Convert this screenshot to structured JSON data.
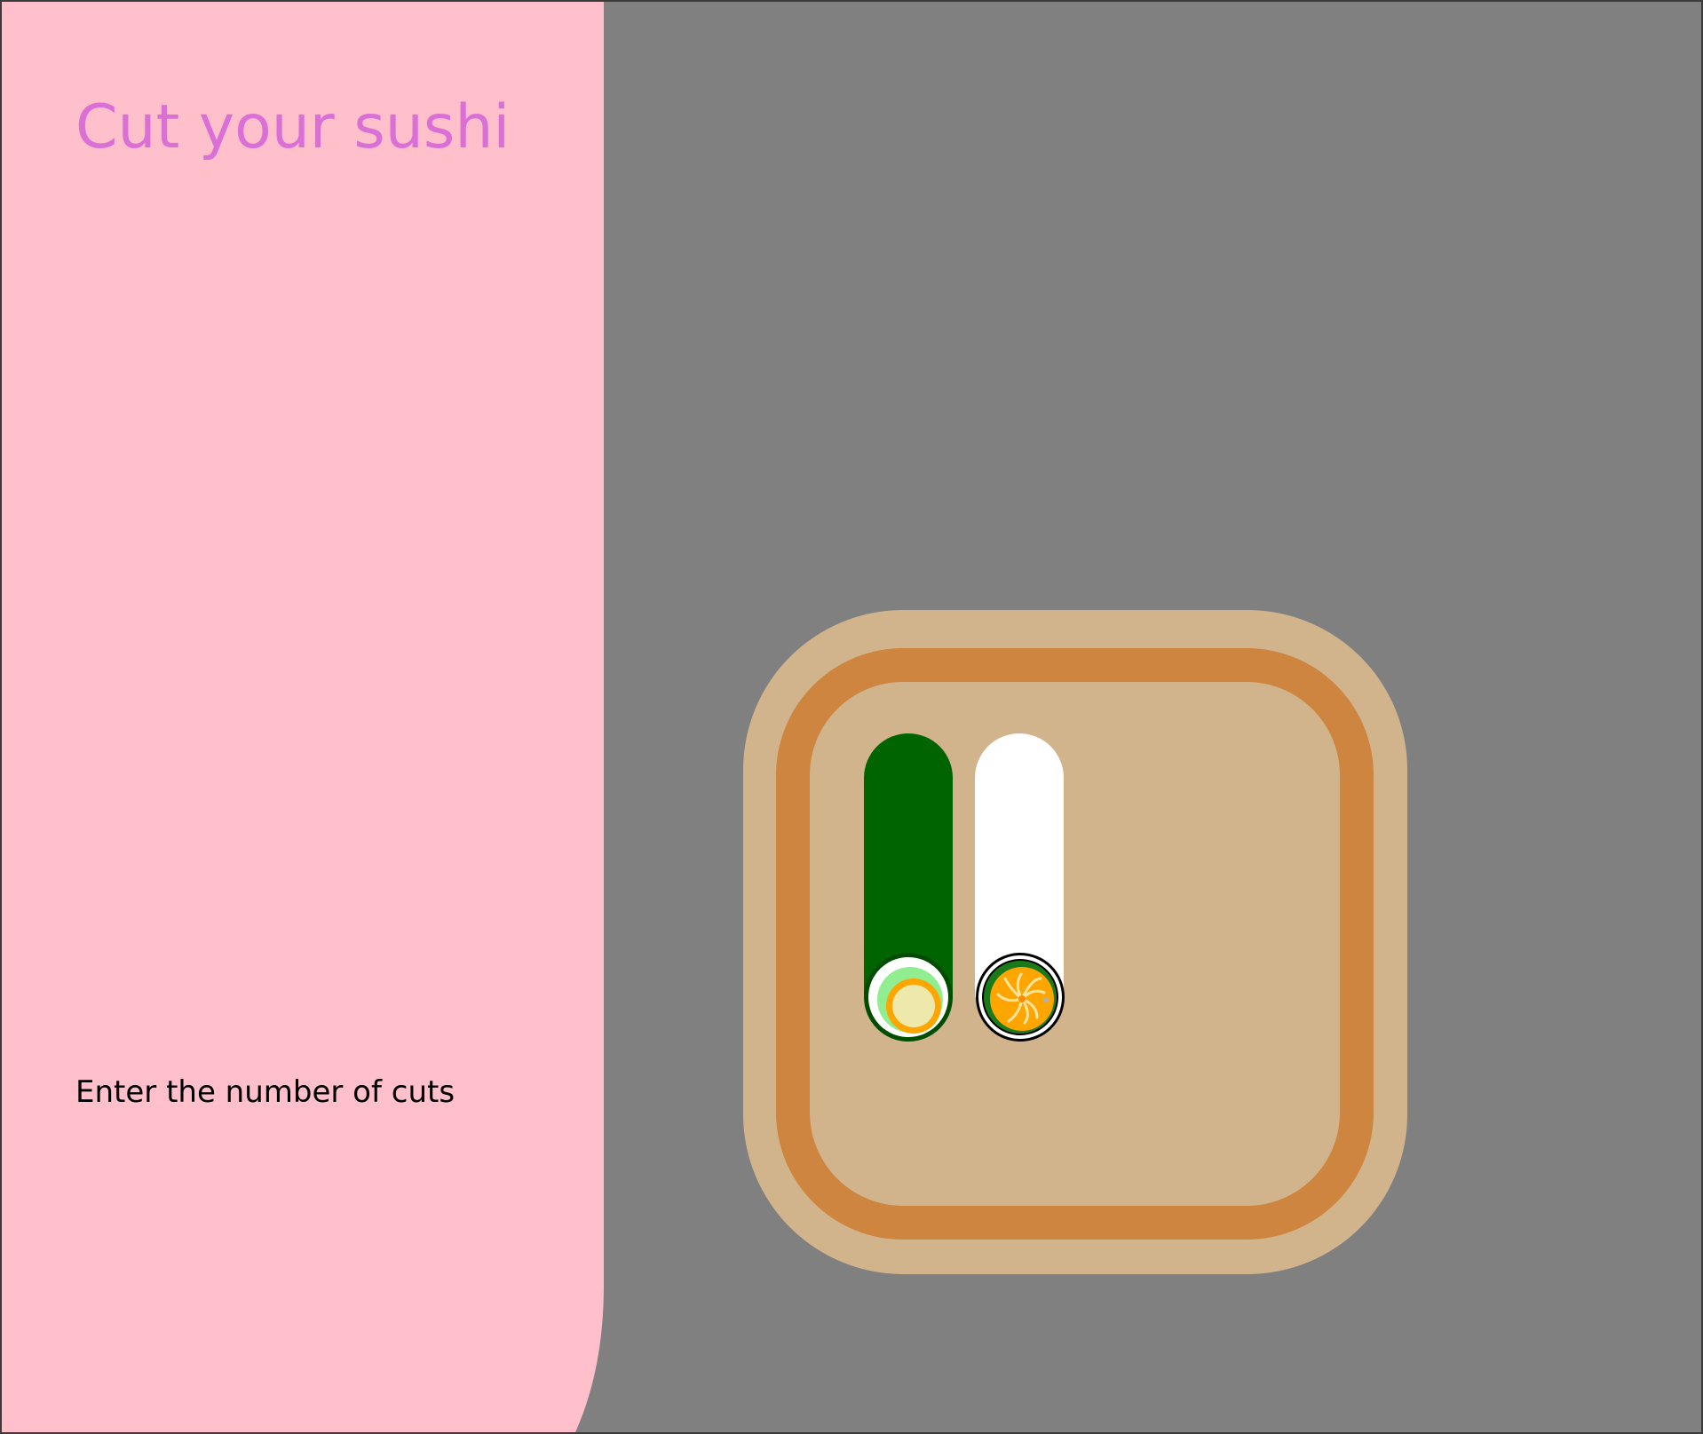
{
  "game": {
    "title": "Cut your sushi",
    "instructions": "Enter the number of cuts"
  },
  "colors": {
    "background": "#808080",
    "side_panel": "#ffc0cb",
    "title_text": "#da70d6",
    "instruction_text": "#000000",
    "board": "#d2b48c",
    "board_stripe": "#cd853f",
    "nori": "#006400",
    "rice": "#ffffff",
    "cucumber": "#90ee90",
    "filling_orange": "#ffa500",
    "filling_pale": "#eee8aa"
  },
  "rolls": [
    {
      "name": "cucumber-roll",
      "wrapper": "nori",
      "filling": "egg"
    },
    {
      "name": "salmon-roll",
      "wrapper": "rice",
      "filling": "salmon"
    }
  ]
}
